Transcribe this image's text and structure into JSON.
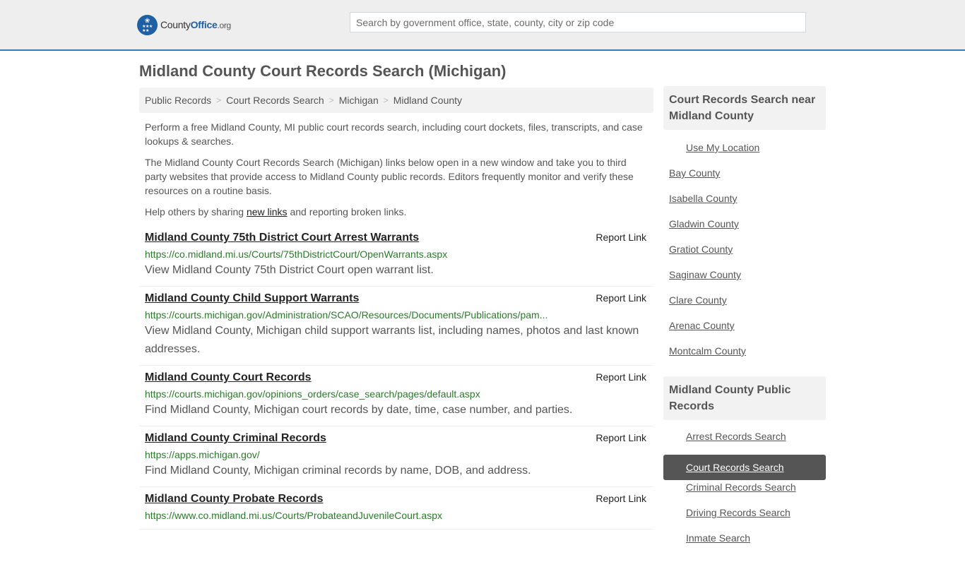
{
  "header": {
    "logo": {
      "name_part1": "County",
      "name_part2": "Office",
      "tld": ".org",
      "icon": "eagle-stars-badge-icon"
    },
    "search": {
      "placeholder": "Search by government office, state, county, city or zip code",
      "value": ""
    }
  },
  "page_title": "Midland County Court Records Search (Michigan)",
  "breadcrumb": [
    "Public Records",
    "Court Records Search",
    "Michigan",
    "Midland County"
  ],
  "intro": {
    "p1": "Perform a free Midland County, MI public court records search, including court dockets, files, transcripts, and case lookups & searches.",
    "p2": "The Midland County Court Records Search (Michigan) links below open in a new window and take you to third party websites that provide access to Midland County public records. Editors frequently monitor and verify these resources on a routine basis.",
    "p3_before": "Help others by sharing ",
    "p3_link": "new links",
    "p3_after": " and reporting broken links."
  },
  "report_label": "Report Link",
  "results": [
    {
      "title": "Midland County 75th District Court Arrest Warrants",
      "url": "https://co.midland.mi.us/Courts/75thDistrictCourt/OpenWarrants.aspx",
      "desc": "View Midland County 75th District Court open warrant list."
    },
    {
      "title": "Midland County Child Support Warrants",
      "url": "https://courts.michigan.gov/Administration/SCAO/Resources/Documents/Publications/pam...",
      "desc": "View Midland County, Michigan child support warrants list, including names, photos and last known addresses."
    },
    {
      "title": "Midland County Court Records",
      "url": "https://courts.michigan.gov/opinions_orders/case_search/pages/default.aspx",
      "desc": "Find Midland County, Michigan court records by date, time, case number, and parties."
    },
    {
      "title": "Midland County Criminal Records",
      "url": "https://apps.michigan.gov/",
      "desc": "Find Midland County, Michigan criminal records by name, DOB, and address."
    },
    {
      "title": "Midland County Probate Records",
      "url": "https://www.co.midland.mi.us/Courts/ProbateandJuvenileCourt.aspx",
      "desc": ""
    }
  ],
  "sidebar": {
    "nearby": {
      "heading": "Court Records Search near Midland County",
      "use_location": "Use My Location",
      "items": [
        "Bay County",
        "Isabella County",
        "Gladwin County",
        "Gratiot County",
        "Saginaw County",
        "Clare County",
        "Arenac County",
        "Montcalm County"
      ]
    },
    "public_records": {
      "heading": "Midland County Public Records",
      "items": [
        {
          "label": "Arrest Records Search",
          "active": false
        },
        {
          "label": "Court Records Search",
          "active": true
        },
        {
          "label": "Criminal Records Search",
          "active": false
        },
        {
          "label": "Driving Records Search",
          "active": false
        },
        {
          "label": "Inmate Search",
          "active": false
        }
      ]
    }
  },
  "colors": {
    "accent": "#3a7db5",
    "logo_blue": "#1f5fa3",
    "url_green": "#2a7a2a",
    "active_bg": "#555555"
  }
}
